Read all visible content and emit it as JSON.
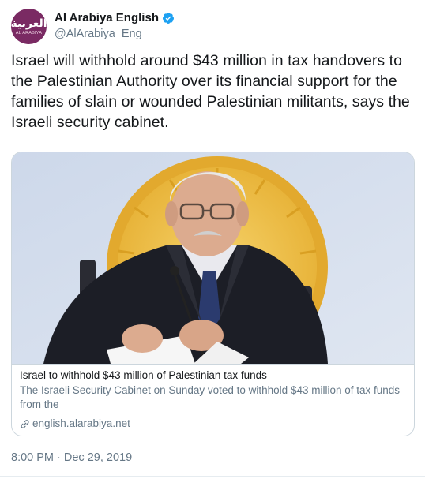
{
  "author": {
    "display_name": "Al Arabiya English",
    "handle": "@AlArabiya_Eng",
    "avatar_text_ar": "العربية",
    "avatar_text_en": "AL ARABIYA",
    "verified": true
  },
  "tweet": {
    "text": "Israel will withhold around $43 million in tax handovers to the Palestinian Authority over its financial support for the families of slain or wounded Palestinian militants, says the Israeli security cabinet.",
    "timestamp": "8:00 PM · Dec 29, 2019"
  },
  "card": {
    "title": "Israel to withhold $43 million of Palestinian tax funds",
    "description": "The Israeli Security Cabinet on Sunday voted to withhold $43 million of tax funds from the",
    "domain": "english.alarabiya.net"
  },
  "colors": {
    "brand": "#7a2a63",
    "verified": "#1da1f2",
    "secondary_text": "#657786",
    "border": "#ccd6dd"
  },
  "icons": [
    "verified-badge-icon",
    "link-icon"
  ]
}
